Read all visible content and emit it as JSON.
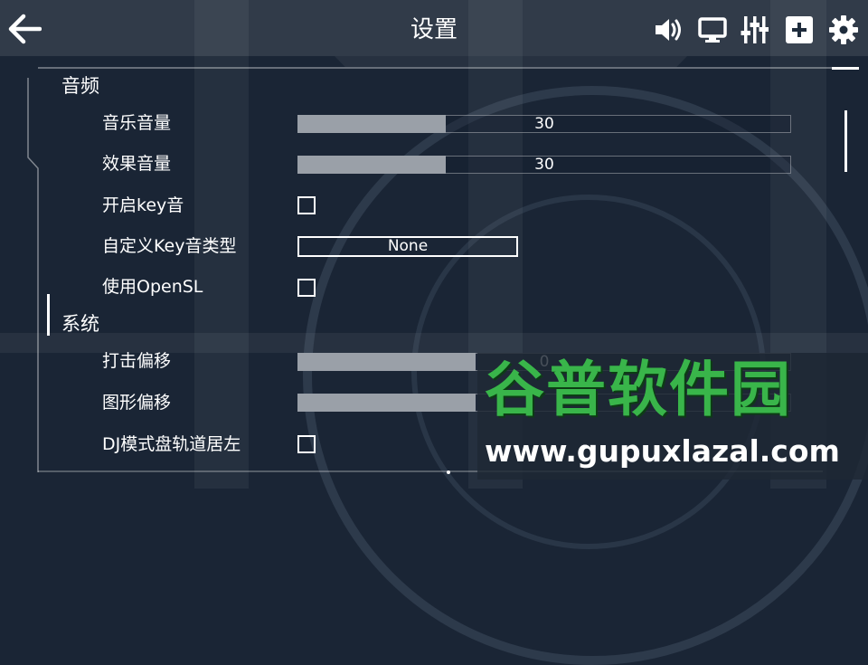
{
  "header": {
    "title": "设置"
  },
  "icons": {
    "back": "arrow-left-icon",
    "sound": "speaker-icon",
    "display": "monitor-icon",
    "mixer": "sliders-icon",
    "add": "plus-icon",
    "settings": "gear-icon"
  },
  "sections": {
    "audio": {
      "title": "音频",
      "music_volume": {
        "label": "音乐音量",
        "value": "30",
        "fill": 0.3
      },
      "effect_volume": {
        "label": "效果音量",
        "value": "30",
        "fill": 0.3
      },
      "key_sound": {
        "label": "开启key音",
        "checked": false
      },
      "custom_key_type": {
        "label": "自定义Key音类型",
        "value": "None"
      },
      "use_opensl": {
        "label": "使用OpenSL",
        "checked": false
      }
    },
    "system": {
      "title": "系统",
      "hit_offset": {
        "label": "打击偏移",
        "value": "0",
        "fill": 0.36
      },
      "graphics_offset": {
        "label": "图形偏移",
        "fill": 0.36
      },
      "dj_lane_left": {
        "label": "DJ模式盘轨道居左",
        "checked": false
      }
    }
  },
  "watermark": {
    "title": "谷普软件园",
    "url": "www.gupuxlazal.com"
  },
  "colors": {
    "background": "#1a2535",
    "slider_fill": "#9aa0a8",
    "watermark_green": "#39b54a"
  }
}
